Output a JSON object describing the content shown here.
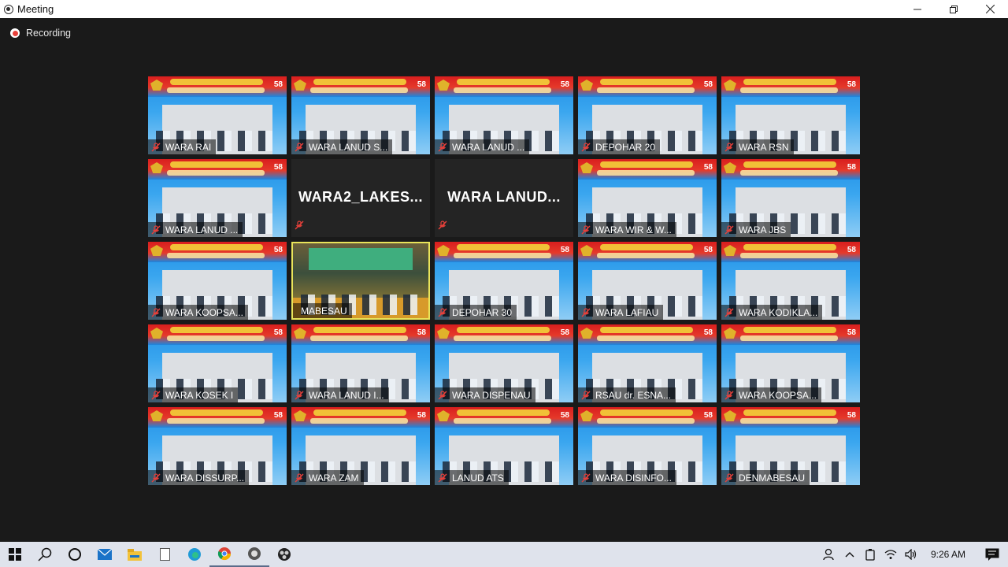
{
  "window": {
    "title": "Meeting"
  },
  "recording": {
    "label": "Recording"
  },
  "tiles": [
    {
      "name": "WARA RAI",
      "type": "video"
    },
    {
      "name": "WARA LANUD S...",
      "type": "video"
    },
    {
      "name": "WARA LANUD ...",
      "type": "video"
    },
    {
      "name": "DEPOHAR 20",
      "type": "video"
    },
    {
      "name": "WARA RSN",
      "type": "video"
    },
    {
      "name": "WARA LANUD ...",
      "type": "video"
    },
    {
      "name": "WARA2_LAKES...",
      "type": "no-video"
    },
    {
      "name": "WARA  LANUD...",
      "type": "no-video"
    },
    {
      "name": "WARA WIR & W...",
      "type": "video"
    },
    {
      "name": "WARA JBS",
      "type": "video"
    },
    {
      "name": "WARA KOOPSA...",
      "type": "video"
    },
    {
      "name": "MABESAU",
      "type": "active-speaker"
    },
    {
      "name": "DEPOHAR 30",
      "type": "video"
    },
    {
      "name": "WARA LAFIAU",
      "type": "video"
    },
    {
      "name": "WARA KODIKLA...",
      "type": "video"
    },
    {
      "name": "WARA KOSEK I",
      "type": "video"
    },
    {
      "name": "WARA LANUD I...",
      "type": "video"
    },
    {
      "name": "WARA DISPENAU",
      "type": "video"
    },
    {
      "name": "RSAU dr. ESNA...",
      "type": "video"
    },
    {
      "name": "WARA KOOPSA...",
      "type": "video"
    },
    {
      "name": "WARA DISSURP...",
      "type": "video"
    },
    {
      "name": "WARA ZAM",
      "type": "video"
    },
    {
      "name": "LANUD ATS",
      "type": "video"
    },
    {
      "name": "WARA DISINFO...",
      "type": "video"
    },
    {
      "name": "DENMABESAU",
      "type": "video"
    }
  ],
  "badge_text": "58",
  "taskbar": {
    "clock": "9:26 AM",
    "apps": [
      "start-icon",
      "search-icon",
      "cortana-icon",
      "mail-icon",
      "file-explorer-icon",
      "notepad-icon",
      "edge-icon",
      "chrome-icon",
      "meeting-app-icon",
      "obs-icon"
    ]
  },
  "colors": {
    "active_speaker_border": "#e9e45a",
    "muted_mic": "#e8403a"
  }
}
